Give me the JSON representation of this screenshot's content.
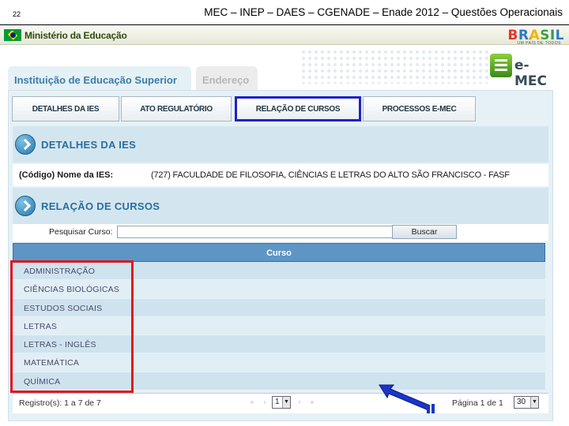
{
  "slide": {
    "number": "22",
    "title": "MEC – INEP – DAES – CGENADE – Enade 2012 – Questões Operacionais"
  },
  "gov_bar": {
    "ministry": "Ministério da Educação",
    "brasil": "BRASIL",
    "brasil_sub": "UM PAÍS DE TODOS"
  },
  "emec": {
    "logo_text": "e-MEC"
  },
  "top_tabs": [
    {
      "label": "Instituição de Educação Superior"
    },
    {
      "label": "Endereço"
    }
  ],
  "sub_tabs": [
    {
      "label": "DETALHES DA IES"
    },
    {
      "label": "ATO REGULATÓRIO"
    },
    {
      "label": "RELAÇÃO DE CURSOS"
    },
    {
      "label": "PROCESSOS E-MEC"
    }
  ],
  "sections": {
    "ies_title": "DETALHES DA IES",
    "courses_title": "RELAÇÃO DE CURSOS"
  },
  "ies": {
    "label": "(Código) Nome da IES:",
    "value": "(727) FACULDADE DE FILOSOFIA, CIÊNCIAS E LETRAS DO ALTO SÃO FRANCISCO - FASF"
  },
  "search": {
    "label": "Pesquisar Curso:",
    "value": "",
    "button": "Buscar"
  },
  "grid": {
    "header": "Curso",
    "rows": [
      "ADMINISTRAÇÃO",
      "CIÊNCIAS BIOLÓGICAS",
      "ESTUDOS SOCIAIS",
      "LETRAS",
      "LETRAS - INGLÊS",
      "MATEMÁTICA",
      "QUÍMICA"
    ]
  },
  "pager": {
    "records": "Registro(s): 1 a 7 de 7",
    "first": "«",
    "prev": "‹",
    "page_value": "1",
    "next": "›",
    "last": "»",
    "page_info": "Página 1 de 1",
    "page_size": "30"
  },
  "colors": {
    "highlight_blue": "#1e22c9",
    "highlight_red": "#e0161c",
    "header_blue": "#5d96c5",
    "section_title": "#2a6e9c"
  }
}
